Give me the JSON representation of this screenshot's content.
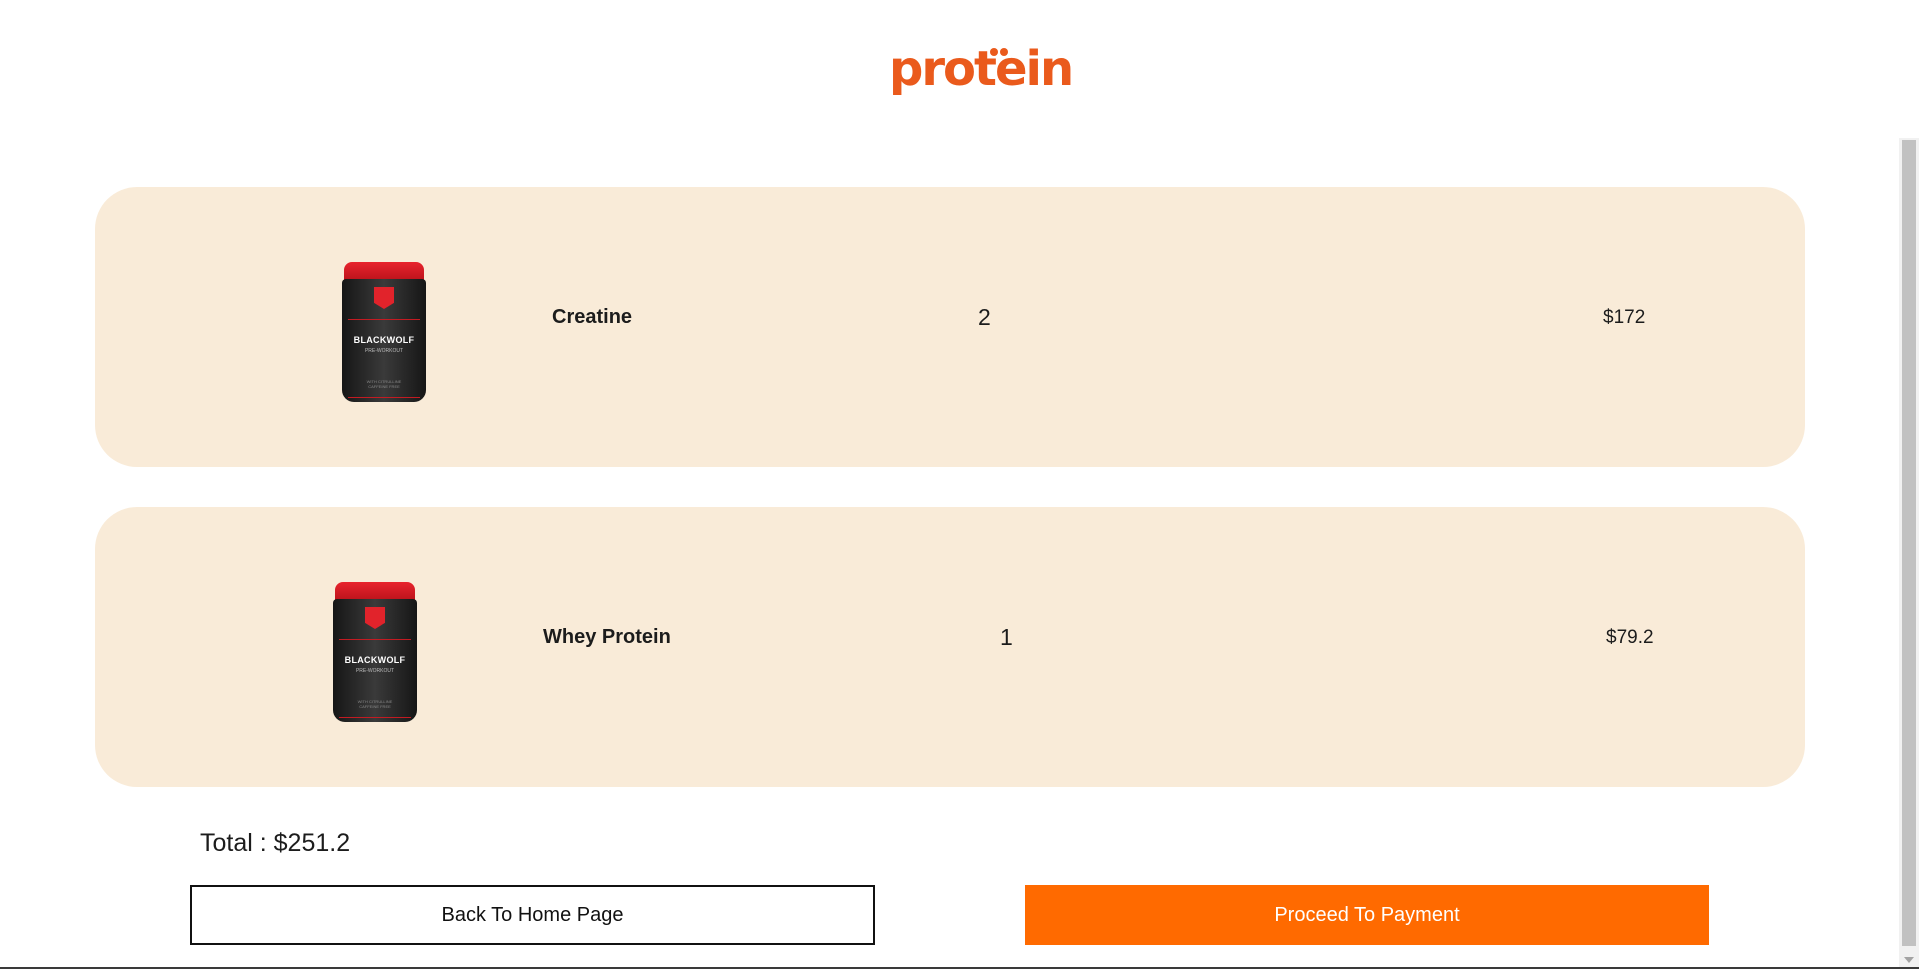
{
  "header": {
    "logo_text": "protein",
    "logo_color": "#ea5a1c"
  },
  "cart": {
    "items": [
      {
        "name": "Creatine",
        "quantity": "2",
        "price": "$172",
        "image": {
          "brand": "BLACKWOLF",
          "subtitle": "PRE-WORKOUT",
          "fine_print_1": "WITH CITRULLINE",
          "fine_print_2": "CAFFEINE FREE"
        }
      },
      {
        "name": "Whey Protein",
        "quantity": "1",
        "price": "$79.2",
        "image": {
          "brand": "BLACKWOLF",
          "subtitle": "PRE-WORKOUT",
          "fine_print_1": "WITH CITRULLINE",
          "fine_print_2": "CAFFEINE FREE"
        }
      }
    ],
    "total_label": "Total : $251.2"
  },
  "actions": {
    "back_label": "Back To Home Page",
    "proceed_label": "Proceed To Payment"
  },
  "colors": {
    "card_background": "#f9ebd8",
    "accent": "#ff6a00"
  }
}
